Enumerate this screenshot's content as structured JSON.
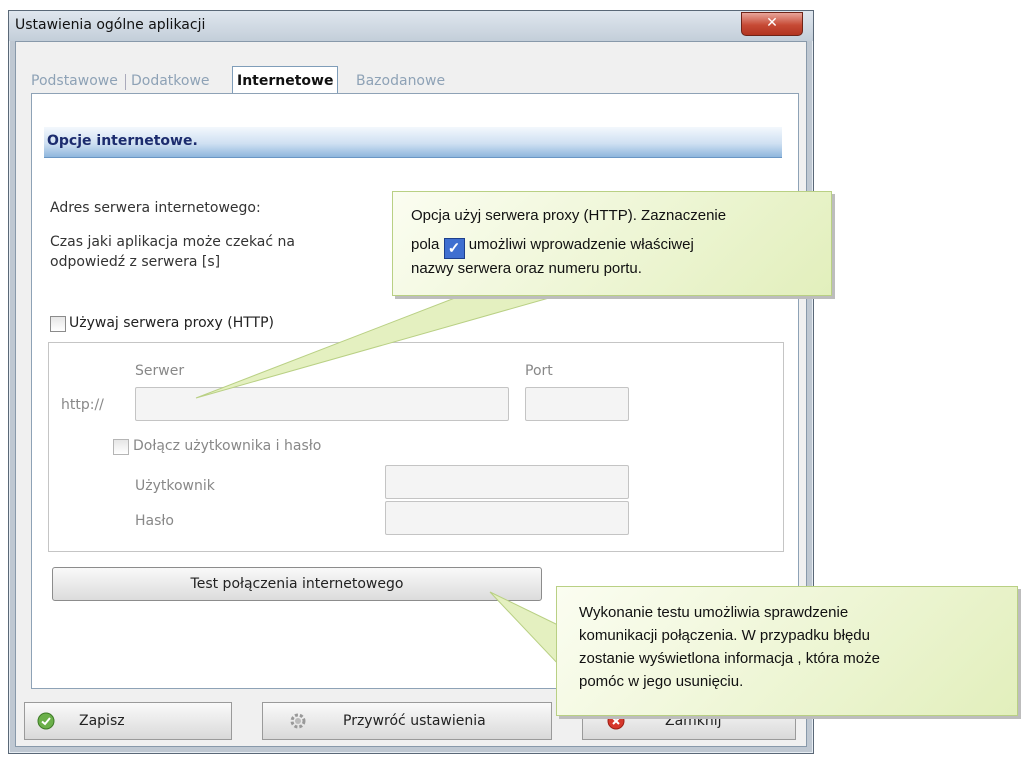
{
  "window": {
    "title": "Ustawienia ogólne aplikacji",
    "close_icon": "close-icon"
  },
  "tabs": [
    {
      "label": "Podstawowe",
      "active": false
    },
    {
      "label": "Dodatkowe",
      "active": false
    },
    {
      "label": "Internetowe",
      "active": true
    },
    {
      "label": "Bazodanowe",
      "active": false
    }
  ],
  "section": {
    "title": "Opcje internetowe.",
    "server_address_label": "Adres serwera internetowego:",
    "timeout_label_line1": "Czas jaki aplikacja może czekać na",
    "timeout_label_line2": "odpowiedź z serwera [s]",
    "proxy_checkbox_label": "Używaj serwera proxy (HTTP)",
    "proxy_checked": false
  },
  "proxy_group": {
    "server_label": "Serwer",
    "port_label": "Port",
    "prefix": "http://",
    "server_value": "",
    "port_value": "",
    "auth_checkbox_label": "Dołącz użytkownika i hasło",
    "auth_checked": false,
    "user_label": "Użytkownik",
    "password_label": "Hasło",
    "user_value": "",
    "password_value": ""
  },
  "test_button": "Test połączenia internetowego",
  "footer": {
    "save": "Zapisz",
    "restore": "Przywróć ustawienia",
    "close": "Zamknij"
  },
  "callouts": {
    "proxy_line1": "Opcja użyj serwera proxy (HTTP). Zaznaczenie",
    "proxy_line2_pre": "pola",
    "proxy_line2_post": "umożliwi wprowadzenie właściwej",
    "proxy_line3": "nazwy serwera oraz numeru portu.",
    "test_line1": "Wykonanie testu umożliwia sprawdzenie",
    "test_line2": "komunikacji połączenia. W przypadku błędu",
    "test_line3": "zostanie wyświetlona informacja , która może",
    "test_line4": "pomóc w jego usunięciu."
  },
  "colors": {
    "accent_blue": "#1c2c6e",
    "callout_bg": "#e8f2c6",
    "close_red": "#c64a35"
  }
}
